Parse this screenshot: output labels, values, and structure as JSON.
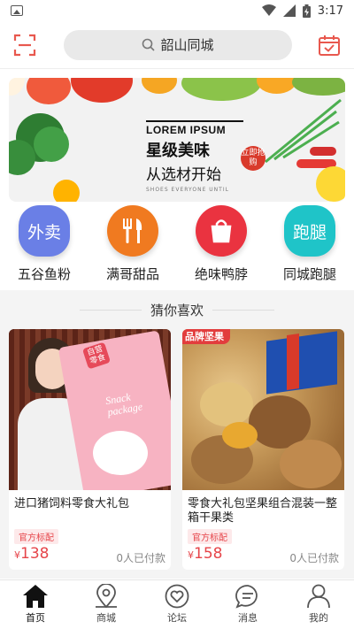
{
  "status_bar": {
    "time": "3:17"
  },
  "header": {
    "search_text": "韶山同城"
  },
  "banner": {
    "heading_en": "LOREM IPSUM",
    "title1": "星级美味",
    "title2": "从选材开始",
    "small_text": "SHOES EVERYONE UNTIL",
    "badge": "立即抢购"
  },
  "categories": [
    {
      "icon_text": "外卖",
      "label": "五谷鱼粉",
      "color": "#6a7fe6"
    },
    {
      "icon_text": "",
      "label": "满哥甜品",
      "color": "#f07a20"
    },
    {
      "icon_text": "",
      "label": "绝味鸭脖",
      "color": "#ea3340"
    },
    {
      "icon_text": "跑腿",
      "label": "同城跑腿",
      "color": "#1fc4c8"
    }
  ],
  "section": {
    "title": "猜你喜欢"
  },
  "products": [
    {
      "name": "进口猪饲料零食大礼包",
      "tag": "官方标配",
      "currency": "¥",
      "price": "138",
      "sold": "0人已付款",
      "photo_text": "Snack package",
      "photo_label": "自营零食"
    },
    {
      "name": "零食大礼包坚果组合混装一整箱干果类",
      "tag": "官方标配",
      "currency": "¥",
      "price": "158",
      "sold": "0人已付款",
      "photo_label": "品牌坚果"
    }
  ],
  "nav": [
    {
      "label": "首页",
      "icon": "home-icon",
      "active": true
    },
    {
      "label": "商城",
      "icon": "location-pin-icon",
      "active": false
    },
    {
      "label": "论坛",
      "icon": "heart-icon",
      "active": false
    },
    {
      "label": "消息",
      "icon": "chat-icon",
      "active": false
    },
    {
      "label": "我的",
      "icon": "user-icon",
      "active": false
    }
  ],
  "colors": {
    "accent": "#e6454a",
    "header_icons": "#e8584e"
  }
}
